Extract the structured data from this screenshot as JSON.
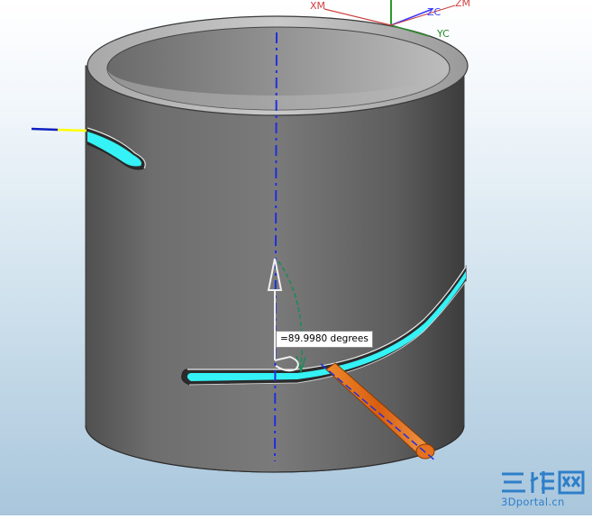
{
  "viewport": {
    "background_top": "#ffffff",
    "background_bottom": "#a9c6dc",
    "model": "cylindrical sleeve with two slots",
    "slot_highlight_color": "#34f2f5",
    "body_color": "#6f6f6f",
    "handle_color": "#e6711e"
  },
  "axes": {
    "xm": "XM",
    "zc": "ZC",
    "zm": "ZM",
    "yc": "YC",
    "x_color": "#d04040",
    "y_color": "#2a8a2a",
    "z_color": "#3a3aff"
  },
  "angle_tooltip": {
    "text": "=89.9980 degrees"
  },
  "watermark": {
    "glyphs": "三维网",
    "text": "3Dportal.cn",
    "color": "#2f7fc9"
  },
  "icons": [
    "coordinate-system-icon",
    "rotation-arc-icon",
    "direction-arrow-icon",
    "axis-handle-icon"
  ]
}
